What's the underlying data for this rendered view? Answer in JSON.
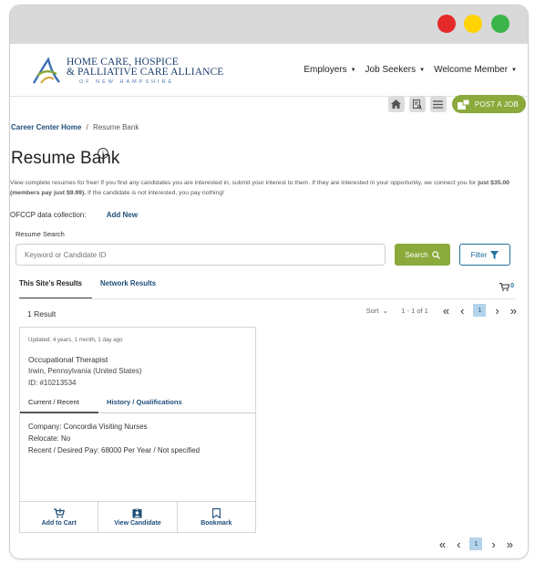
{
  "window": {
    "traffic_colors": [
      "#e52a2a",
      "#ffd400",
      "#3bb54a"
    ]
  },
  "header": {
    "logo": {
      "line1": "HOME CARE, HOSPICE",
      "line2": "& PALLIATIVE CARE ALLIANCE",
      "line3": "OF NEW HAMPSHIRE"
    },
    "nav": [
      {
        "label": "Employers"
      },
      {
        "label": "Job Seekers"
      },
      {
        "label": "Welcome Member"
      }
    ]
  },
  "toolbar": {
    "icons": [
      "home-icon",
      "resume-search-icon",
      "list-icon"
    ],
    "post_job_label": "POST A JOB"
  },
  "breadcrumb": {
    "home": "Career Center Home",
    "separator": "/",
    "current": "Resume Bank"
  },
  "page": {
    "title": "Resume Bank",
    "info_glyph": "i",
    "intro_part1": "View complete resumes for free! If you find any candidates you are interested in, submit your interest to them. If they are interested in your opportunity, we connect you for ",
    "intro_price": "just $35.00 (members pay just $9.99).",
    "intro_part2": " If the candidate is not interested, you pay nothing!"
  },
  "ofccp": {
    "label": "OFCCP data collection:",
    "add_label": "Add New"
  },
  "search": {
    "label": "Resume Search",
    "placeholder": "Keyword or Candidate ID",
    "search_label": "Search",
    "filter_label": "Filter"
  },
  "results_tabs": {
    "active": "This Site's Results",
    "other": "Network Results",
    "cart_count": "0"
  },
  "results": {
    "count_text": "1 Result",
    "sort_label": "Sort",
    "range_text": "1 - 1 of 1",
    "current_page": "1"
  },
  "candidate": {
    "updated": "Updated: 4 years, 1 month, 1 day ago",
    "title": "Occupational Therapist",
    "location": "Irwin, Pennsylvania (United States)",
    "id": "ID: #10213534",
    "tab_active": "Current / Recent",
    "tab_other": "History / Qualifications",
    "company": "Company: Concordia Visiting Nurses",
    "relocate": "Relocate: No",
    "pay": "Recent / Desired Pay: 68000 Per Year / Not specified",
    "actions": {
      "add_to_cart": "Add to Cart",
      "view": "View Candidate",
      "bookmark": "Bookmark"
    }
  },
  "colors": {
    "accent_green": "#8aaa3b",
    "link_blue": "#1f4e79",
    "filter_blue": "#1f6f9e",
    "page_highlight": "#b3d3ea"
  }
}
